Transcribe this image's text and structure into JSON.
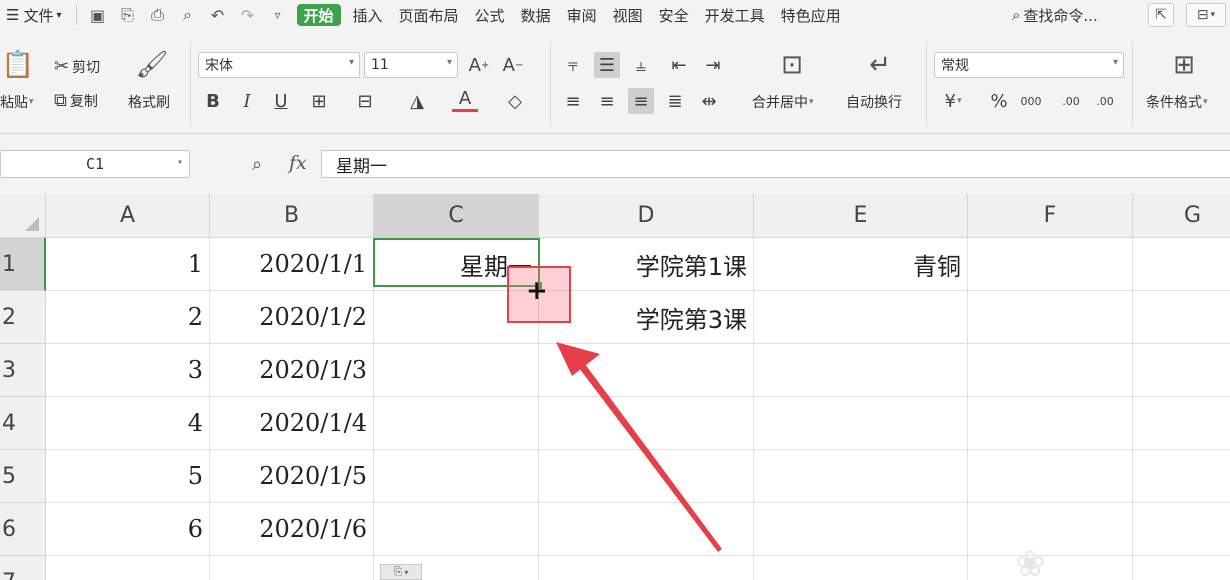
{
  "menubar": {
    "file": "文件",
    "tabs": [
      "开始",
      "插入",
      "页面布局",
      "公式",
      "数据",
      "审阅",
      "视图",
      "安全",
      "开发工具",
      "特色应用"
    ],
    "search": "查找命令..."
  },
  "ribbon": {
    "paste": "粘贴",
    "cut": "剪切",
    "copy": "复制",
    "format_painter": "格式刷",
    "font_name": "宋体",
    "font_size": "11",
    "bold": "B",
    "italic": "I",
    "underline": "U",
    "font_color_letter": "A",
    "merge_center": "合并居中",
    "wrap_text": "自动换行",
    "number_format": "常规",
    "percent": "%",
    "thousands": "000",
    "inc_decimal": ".00",
    "dec_decimal": ".00",
    "cond_format": "条件格式"
  },
  "formula_bar": {
    "name_box": "C1",
    "fx": "fx",
    "value": "星期一"
  },
  "sheet": {
    "columns": [
      "A",
      "B",
      "C",
      "D",
      "E",
      "F",
      "G"
    ],
    "rows": [
      "1",
      "2",
      "3",
      "4",
      "5",
      "6",
      "7"
    ],
    "cells": {
      "A1": "1",
      "B1": "2020/1/1",
      "C1": "星期一",
      "D1": "学院第1课",
      "E1": "青铜",
      "A2": "2",
      "B2": "2020/1/2",
      "D2": "学院第3课",
      "A3": "3",
      "B3": "2020/1/3",
      "A4": "4",
      "B4": "2020/1/4",
      "A5": "5",
      "B5": "2020/1/5",
      "A6": "6",
      "B6": "2020/1/6"
    },
    "selected_cell": "C1",
    "accent_color": "#3a9a47",
    "highlight_color": "#e5404a"
  },
  "colors": {
    "start_tab": "#3fa14b",
    "selection": "#3a9a47",
    "annotation": "#e5404a"
  }
}
